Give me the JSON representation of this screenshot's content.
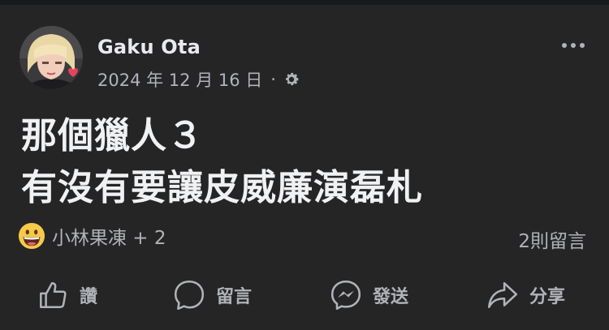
{
  "post": {
    "author": "Gaku Ota",
    "date": "2024 年 12 月 16 日",
    "separator": "·",
    "privacy_icon": "gear-icon",
    "text_line_1": "那個獵人３",
    "text_line_2": "有沒有要讓皮威廉演磊札"
  },
  "reactions": {
    "emoji_icon": "grinning-face-emoji",
    "summary": "小林果凍 + 2",
    "comment_count": "2則留言"
  },
  "actions": {
    "like_label": "讚",
    "comment_label": "留言",
    "send_label": "發送",
    "share_label": "分享"
  },
  "colors": {
    "background": "#252526",
    "text_primary": "#f0f1f3",
    "text_secondary": "#b0b3b8"
  }
}
